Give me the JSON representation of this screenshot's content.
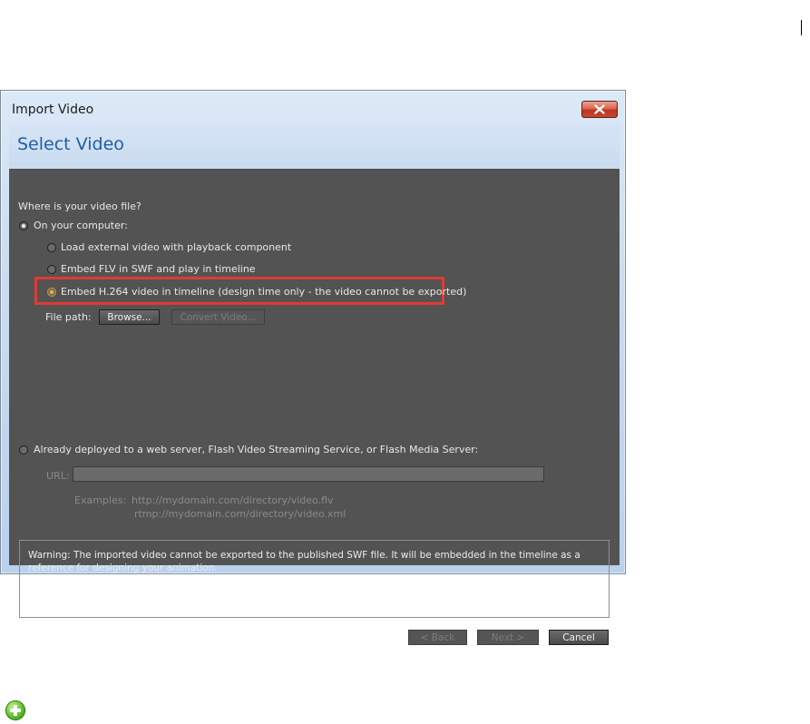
{
  "window": {
    "title": "Import Video",
    "close_glyph": "✕"
  },
  "header": {
    "title": "Select Video"
  },
  "question": "Where is your video file?",
  "options": {
    "computer": {
      "label": "On your computer:",
      "selected": true
    },
    "sub": [
      {
        "label": "Load external video with playback component",
        "selected": false
      },
      {
        "label": "Embed FLV in SWF and play in timeline",
        "selected": false
      },
      {
        "label": "Embed H.264 video in timeline (design time only - the video cannot be exported)",
        "selected": true
      }
    ],
    "server": {
      "label": "Already deployed to a web server, Flash Video Streaming Service, or Flash Media Server:",
      "selected": false
    }
  },
  "file_path": {
    "label": "File path:",
    "browse_label": "Browse...",
    "convert_label": "Convert Video..."
  },
  "url": {
    "label": "URL:",
    "value": "",
    "examples_label": "Examples:",
    "example_1": "http://mydomain.com/directory/video.flv",
    "example_2": "rtmp://mydomain.com/directory/video.xml"
  },
  "warning": "Warning: The imported video cannot be exported to the published SWF file. It will be embedded in the timeline as a reference for designing your animation.",
  "footer": {
    "back_label": "< Back",
    "next_label": "Next >",
    "cancel_label": "Cancel"
  },
  "colors": {
    "panel": "#535353",
    "highlight": "#e03a31",
    "title_blue": "#1f5fa8"
  },
  "icons": {
    "close": "close-icon",
    "add": "plus-icon"
  }
}
